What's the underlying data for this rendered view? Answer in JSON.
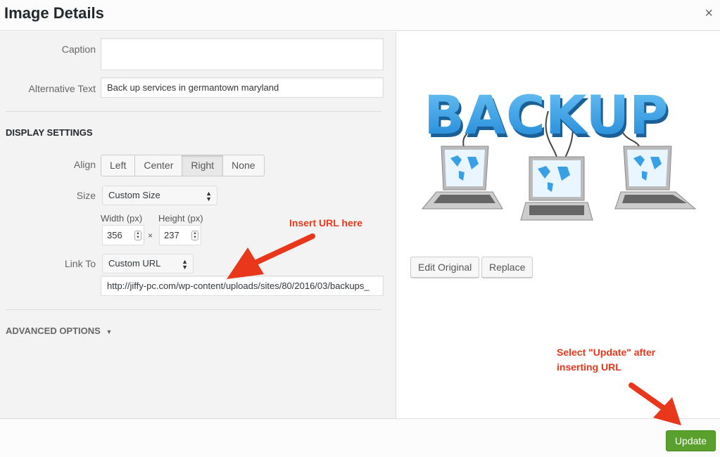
{
  "header": {
    "title": "Image Details",
    "close_glyph": "×"
  },
  "form": {
    "caption_label": "Caption",
    "caption_value": "",
    "alt_label": "Alternative Text",
    "alt_value": "Back up services in germantown maryland"
  },
  "display": {
    "section_title": "DISPLAY SETTINGS",
    "align_label": "Align",
    "align_options": [
      "Left",
      "Center",
      "Right",
      "None"
    ],
    "align_selected": "Right",
    "size_label": "Size",
    "size_value": "Custom Size",
    "width_label": "Width (px)",
    "height_label": "Height (px)",
    "width_value": "356",
    "height_value": "237",
    "times": "×",
    "link_label": "Link To",
    "link_value": "Custom URL",
    "url_value": "http://jiffy-pc.com/wp-content/uploads/sites/80/2016/03/backups_"
  },
  "advanced": {
    "label": "ADVANCED OPTIONS",
    "arrow": "▼"
  },
  "preview": {
    "logo_text": "BACKUP",
    "edit_original": "Edit Original",
    "replace": "Replace"
  },
  "footer": {
    "update": "Update"
  },
  "annotations": {
    "insert_url": "Insert URL here",
    "select_update_line1": "Select \"Update\" after",
    "select_update_line2": "inserting URL"
  },
  "colors": {
    "accent_green": "#5aa02c",
    "annotation_red": "#e8371b",
    "logo_blue": "#3aa0e6"
  },
  "icons": [
    "close-icon",
    "select-arrows-icon",
    "spinner-icon",
    "caret-down-icon",
    "laptop-icon",
    "world-map-icon",
    "arrow-icon"
  ]
}
